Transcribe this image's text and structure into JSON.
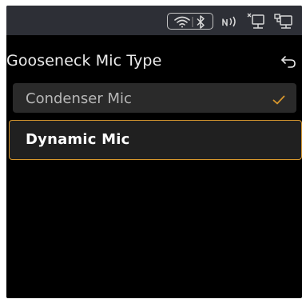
{
  "status_bar": {
    "icons": [
      "wifi-icon",
      "bluetooth-icon",
      "nfc-icon",
      "network-disconnected-icon",
      "network-icon"
    ]
  },
  "header": {
    "title": "Gooseneck Mic Type",
    "back_icon": "return-arrow-icon"
  },
  "options": [
    {
      "label": "Condenser Mic",
      "selected": true,
      "focused": false
    },
    {
      "label": "Dynamic Mic",
      "selected": false,
      "focused": true
    }
  ],
  "colors": {
    "accent": "#d6962d",
    "status_bar_bg": "#2d2f36",
    "screen_bg": "#000000",
    "option_bg": "#2a2a2a"
  }
}
